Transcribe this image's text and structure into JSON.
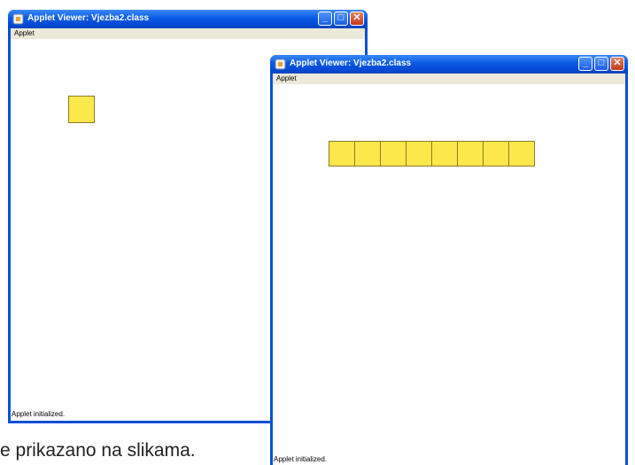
{
  "window_left": {
    "title": "Applet Viewer: Vjezba2.class",
    "menu": "Applet",
    "status": "Applet initialized.",
    "square_count": 1,
    "square_color": "#fce84a"
  },
  "window_right": {
    "title": "Applet Viewer: Vjezba2.class",
    "menu": "Applet",
    "status": "Applet initialized.",
    "square_count": 8,
    "square_color": "#fce84a"
  },
  "buttons": {
    "minimize": "_",
    "maximize": "□",
    "close": "✕"
  },
  "caption": "e prikazano na slikama."
}
